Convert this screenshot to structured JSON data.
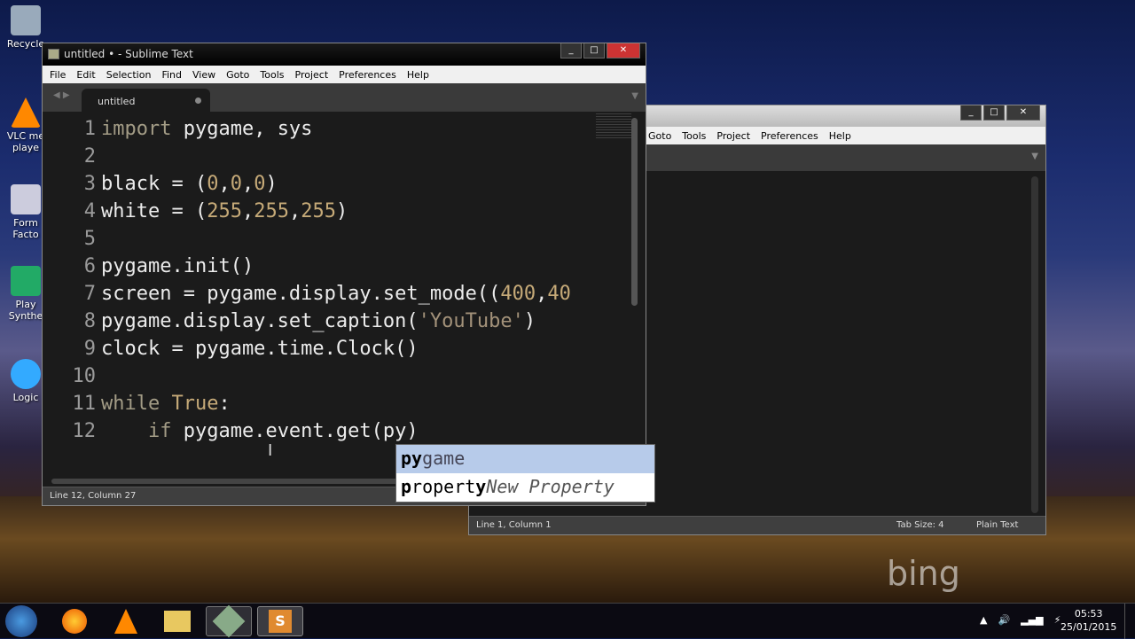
{
  "desktop": {
    "icons": [
      {
        "label": "Recycle"
      },
      {
        "label": "VLC me\nplaye"
      },
      {
        "label": "Form\nFacto"
      },
      {
        "label": "Play\nSynthe"
      },
      {
        "label": "Logic"
      }
    ],
    "watermark": "bing"
  },
  "main_window": {
    "title": "untitled • - Sublime Text",
    "menu": [
      "File",
      "Edit",
      "Selection",
      "Find",
      "View",
      "Goto",
      "Tools",
      "Project",
      "Preferences",
      "Help"
    ],
    "tab": {
      "label": "untitled",
      "modified": true
    },
    "line_numbers": [
      "1",
      "2",
      "3",
      "4",
      "5",
      "6",
      "7",
      "8",
      "9",
      "10",
      "11",
      "12"
    ],
    "status": "Line 12, Column 27"
  },
  "autocomplete": {
    "items": [
      {
        "match": "py",
        "rest": "game",
        "hint": ""
      },
      {
        "match": "p",
        "mid": "ropert",
        "match2": "y",
        "hint": "New Property"
      }
    ],
    "selected": 0
  },
  "back_window": {
    "menu": [
      "Goto",
      "Tools",
      "Project",
      "Preferences",
      "Help"
    ],
    "status_left": "Line 1, Column 1",
    "tab_size": "Tab Size: 4",
    "syntax": "Plain Text"
  },
  "taskbar": {
    "time": "05:53",
    "date": "25/01/2015"
  }
}
